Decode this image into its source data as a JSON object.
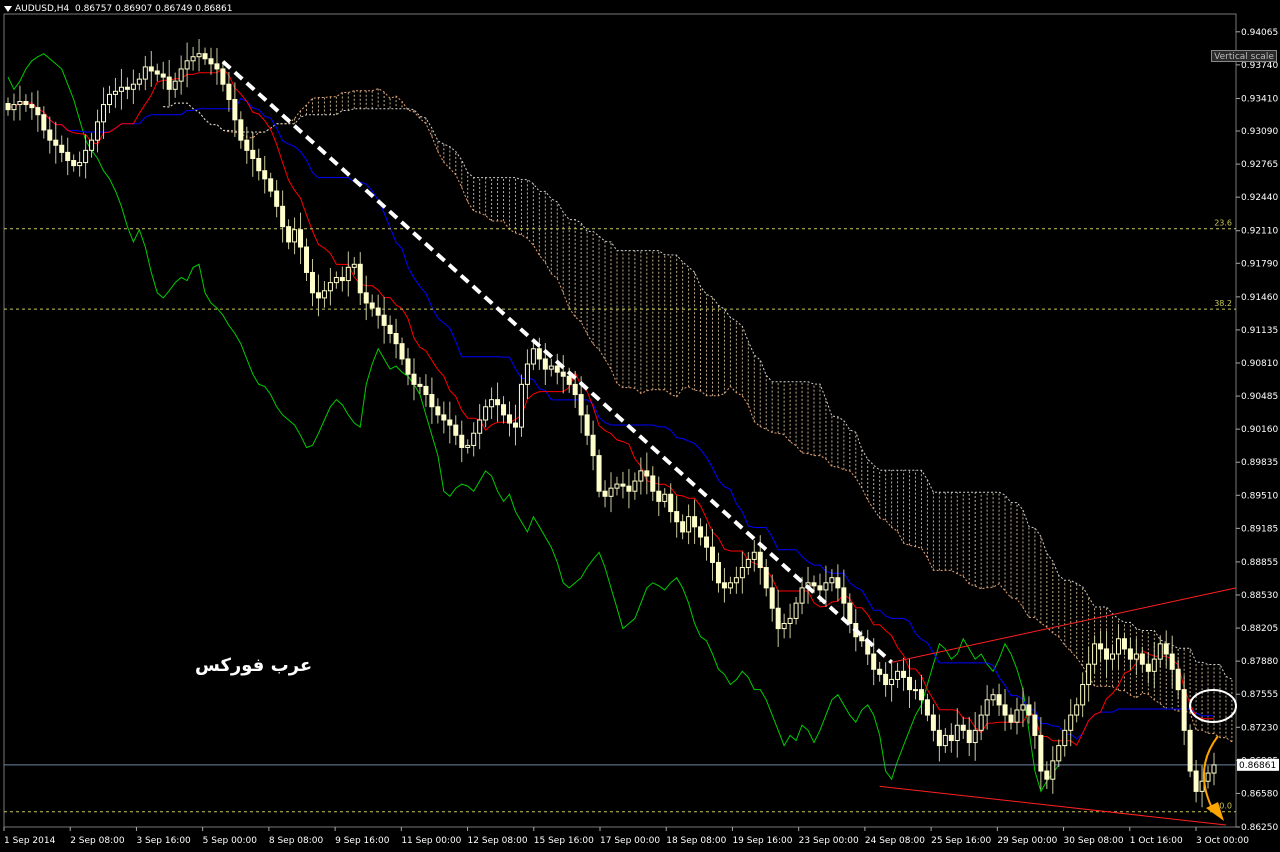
{
  "header": {
    "symbol": "AUDUSD,H4",
    "ohlc": "0.86757 0.86907 0.86749 0.86861"
  },
  "vertical_scale_label": "Vertical scale",
  "watermark": "عرب فوركس",
  "colors": {
    "background": "#000000",
    "grid": "#1a1a1a",
    "candle": "#ffffcc",
    "tenkan": "#ff0000",
    "kijun": "#0000ff",
    "chikou": "#00cc00",
    "kumo": "#ffe4b5",
    "trendline": "#ffffff",
    "channel": "#ff2020",
    "fib": "#c8c85a",
    "current_price": "#6e84a3",
    "arrow": "#ffa500",
    "circle": "#ffffff"
  },
  "chart_data": {
    "type": "candlestick",
    "title": "AUDUSD,H4",
    "y_ticks": [
      "0.94065",
      "0.93740",
      "0.93410",
      "0.93090",
      "0.92765",
      "0.92440",
      "0.92110",
      "0.91790",
      "0.91460",
      "0.91135",
      "0.90810",
      "0.90485",
      "0.90160",
      "0.89835",
      "0.89510",
      "0.89185",
      "0.88855",
      "0.88530",
      "0.88205",
      "0.87880",
      "0.87555",
      "0.87230",
      "0.86905",
      "0.86580",
      "0.86250"
    ],
    "ylim": [
      0.8625,
      0.9424
    ],
    "x_ticks": [
      "1 Sep 2014",
      "2 Sep 08:00",
      "3 Sep 16:00",
      "5 Sep 00:00",
      "8 Sep 08:00",
      "9 Sep 16:00",
      "11 Sep 00:00",
      "12 Sep 08:00",
      "15 Sep 16:00",
      "17 Sep 00:00",
      "18 Sep 08:00",
      "19 Sep 16:00",
      "23 Sep 00:00",
      "24 Sep 08:00",
      "25 Sep 16:00",
      "29 Sep 00:00",
      "30 Sep 08:00",
      "1 Oct 16:00",
      "3 Oct 00:00"
    ],
    "current_price": "0.86861",
    "current_price_value": 0.86861,
    "fib_levels": [
      {
        "label": "23.6",
        "price": 0.9213
      },
      {
        "label": "38.2",
        "price": 0.9134
      },
      {
        "label": "0.0",
        "price": 0.864
      }
    ],
    "close": [
      0.933,
      0.9335,
      0.9338,
      0.9335,
      0.9332,
      0.9325,
      0.931,
      0.93,
      0.9295,
      0.9288,
      0.928,
      0.9275,
      0.9278,
      0.929,
      0.93,
      0.9318,
      0.9335,
      0.9345,
      0.9348,
      0.9352,
      0.935,
      0.9355,
      0.936,
      0.9372,
      0.9368,
      0.9365,
      0.9362,
      0.935,
      0.9358,
      0.937,
      0.9378,
      0.9382,
      0.9385,
      0.938,
      0.9375,
      0.937,
      0.9355,
      0.934,
      0.932,
      0.93,
      0.929,
      0.9282,
      0.927,
      0.9262,
      0.925,
      0.9235,
      0.9215,
      0.92,
      0.9212,
      0.9195,
      0.917,
      0.915,
      0.9145,
      0.9152,
      0.916,
      0.9165,
      0.9162,
      0.9175,
      0.9178,
      0.915,
      0.914,
      0.9135,
      0.9128,
      0.9118,
      0.911,
      0.91,
      0.9085,
      0.907,
      0.906,
      0.9058,
      0.905,
      0.9038,
      0.903,
      0.9025,
      0.902,
      0.901,
      0.8998,
      0.9,
      0.9012,
      0.9025,
      0.9038,
      0.9045,
      0.904,
      0.903,
      0.9022,
      0.9018,
      0.906,
      0.908,
      0.9095,
      0.9085,
      0.9075,
      0.9078,
      0.9072,
      0.9068,
      0.906,
      0.905,
      0.903,
      0.901,
      0.899,
      0.8955,
      0.895,
      0.8958,
      0.8962,
      0.896,
      0.8955,
      0.8965,
      0.8975,
      0.897,
      0.8955,
      0.8945,
      0.8952,
      0.8935,
      0.8925,
      0.8915,
      0.893,
      0.892,
      0.891,
      0.89,
      0.8885,
      0.8865,
      0.886,
      0.8865,
      0.887,
      0.888,
      0.8888,
      0.8895,
      0.888,
      0.886,
      0.884,
      0.882,
      0.8825,
      0.883,
      0.8845,
      0.886,
      0.8865,
      0.8862,
      0.8858,
      0.8865,
      0.887,
      0.886,
      0.8845,
      0.8825,
      0.8812,
      0.8808,
      0.8795,
      0.878,
      0.8775,
      0.8765,
      0.877,
      0.8778,
      0.8772,
      0.876,
      0.876,
      0.875,
      0.8735,
      0.872,
      0.8705,
      0.8715,
      0.871,
      0.8725,
      0.872,
      0.8708,
      0.872,
      0.8735,
      0.875,
      0.8755,
      0.8745,
      0.8735,
      0.8728,
      0.874,
      0.8745,
      0.8735,
      0.8715,
      0.868,
      0.8672,
      0.869,
      0.8705,
      0.872,
      0.8735,
      0.8745,
      0.8765,
      0.8785,
      0.8805,
      0.88,
      0.879,
      0.8795,
      0.881,
      0.88,
      0.879,
      0.8795,
      0.8785,
      0.8778,
      0.879,
      0.8805,
      0.8795,
      0.878,
      0.876,
      0.872,
      0.868,
      0.866,
      0.867,
      0.8678,
      0.8686
    ]
  }
}
